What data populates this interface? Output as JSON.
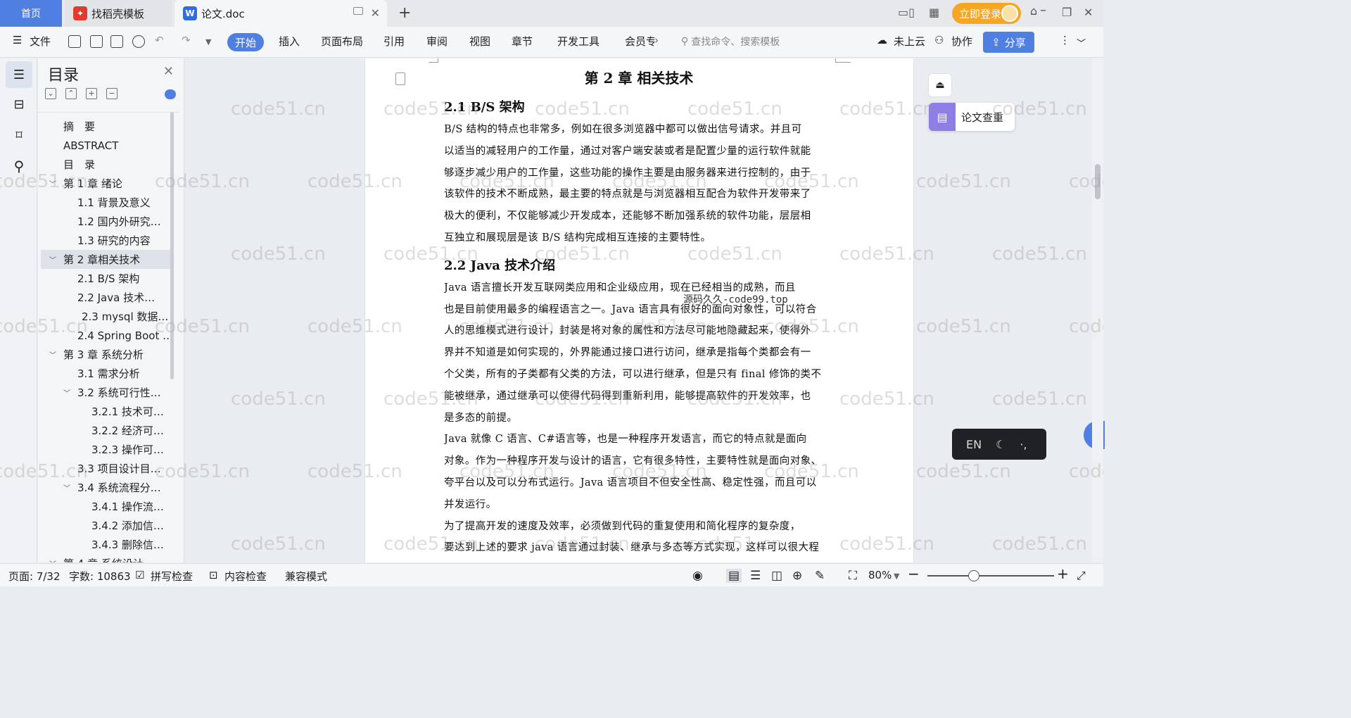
{
  "tabs": {
    "home": "首页",
    "template_tab": "找稻壳模板",
    "doc_tab": "论文.doc",
    "login": "立即登录"
  },
  "ribbon": {
    "file": "文件",
    "items": [
      "开始",
      "插入",
      "页面布局",
      "引用",
      "审阅",
      "视图",
      "章节",
      "开发工具",
      "会员专"
    ],
    "search_placeholder": "查找命令、搜索模板",
    "cloud": "未上云",
    "collab": "协作",
    "share": "分享"
  },
  "toc": {
    "title": "目录",
    "items": [
      {
        "label": "摘　要",
        "level": 1,
        "arrow": ""
      },
      {
        "label": "ABSTRACT",
        "level": 1,
        "arrow": ""
      },
      {
        "label": "目　录",
        "level": 1,
        "arrow": ""
      },
      {
        "label": "第 1 章  绪论",
        "level": 1,
        "arrow": "v"
      },
      {
        "label": "1.1  背景及意义",
        "level": 2,
        "arrow": ""
      },
      {
        "label": "1.2  国内外研究…",
        "level": 2,
        "arrow": ""
      },
      {
        "label": "1.3  研究的内容",
        "level": 2,
        "arrow": ""
      },
      {
        "label": "第 2 章相关技术",
        "level": 1,
        "arrow": "v",
        "selected": true
      },
      {
        "label": "2.1    B/S 架构",
        "level": 2,
        "arrow": ""
      },
      {
        "label": "2.2    Java 技术…",
        "level": 2,
        "arrow": ""
      },
      {
        "label": "2.3 mysql 数据…",
        "level": 2.3,
        "arrow": ""
      },
      {
        "label": "2.4 Spring Boot …",
        "level": 2,
        "arrow": ""
      },
      {
        "label": "第 3 章  系统分析",
        "level": 1,
        "arrow": "v"
      },
      {
        "label": "3.1  需求分析",
        "level": 2,
        "arrow": ""
      },
      {
        "label": "3.2  系统可行性…",
        "level": 2,
        "arrow": "v"
      },
      {
        "label": "3.2.1  技术可…",
        "level": 3,
        "arrow": ""
      },
      {
        "label": "3.2.2  经济可…",
        "level": 3,
        "arrow": ""
      },
      {
        "label": "3.2.3  操作可…",
        "level": 3,
        "arrow": ""
      },
      {
        "label": "3.3  项目设计目…",
        "level": 2,
        "arrow": ""
      },
      {
        "label": "3.4 系统流程分…",
        "level": 2,
        "arrow": "v"
      },
      {
        "label": "3.4.1 操作流…",
        "level": 3,
        "arrow": ""
      },
      {
        "label": "3.4.2 添加信…",
        "level": 3,
        "arrow": ""
      },
      {
        "label": "3.4.3 删除信…",
        "level": 3,
        "arrow": ""
      },
      {
        "label": "第 4 章  系统设计",
        "level": 1,
        "arrow": "v"
      }
    ]
  },
  "document": {
    "chapter_title": "第 2 章  相关技术",
    "sections": [
      {
        "heading": "2.1    B/S 架构",
        "lines": [
          "    B/S 结构的特点也非常多，例如在很多浏览器中都可以做出信号请求。并且可",
          "以适当的减轻用户的工作量，通过对客户端安装或者是配置少量的运行软件就能",
          "够逐步减少用户的工作量，这些功能的操作主要是由服务器来进行控制的，由于",
          "该软件的技术不断成熟，最主要的特点就是与浏览器相互配合为软件开发带来了",
          "极大的便利，不仅能够减少开发成本，还能够不断加强系统的软件功能，层层相",
          "互独立和展现层是该 B/S 结构完成相互连接的主要特性。"
        ]
      },
      {
        "heading": "2.2    Java 技术介绍",
        "lines": [
          "    Java 语言擅长开发互联网类应用和企业级应用，现在已经相当的成熟，而且",
          "也是目前使用最多的编程语言之一。Java 语言具有很好的面向对象性，可以符合",
          "人的思维模式进行设计，封装是将对象的属性和方法尽可能地隐藏起来，使得外",
          "界并不知道是如何实现的，外界能通过接口进行访问，继承是指每个类都会有一",
          "个父类，所有的子类都有父类的方法，可以进行继承，但是只有 final 修饰的类不",
          "能被继承，通过继承可以使得代码得到重新利用，能够提高软件的开发效率，也",
          "是多态的前提。",
          "    Java 就像 C 语言、C#语言等，也是一种程序开发语言，而它的特点就是面向",
          "对象。作为一种程序开发与设计的语言，它有很多特性，主要特性就是面向对象、",
          "夸平台以及可以分布式运行。Java 语言项目不但安全性高、稳定性强，而且可以",
          "并发运行。",
          "    为了提高开发的速度及效率，必须做到代码的重复使用和简化程序的复杂度，",
          "要达到上述的要求 java 语言通过封装、继承与多态等方式实现，这样可以很大程"
        ]
      }
    ],
    "overlay": "源码久久-code99.top"
  },
  "right_panel": {
    "check_label": "论文查重",
    "ime_lang": "EN",
    "ime_punct": "·,"
  },
  "status": {
    "page": "页面: 7/32",
    "words": "字数: 10863",
    "spell": "拼写检查",
    "content_check": "内容检查",
    "compat": "兼容模式",
    "zoom": "80%"
  },
  "watermark": "code51.cn",
  "colors": {
    "accent": "#4f7fe0",
    "login": "#f5a623",
    "check_icon": "#8f7ee6"
  }
}
